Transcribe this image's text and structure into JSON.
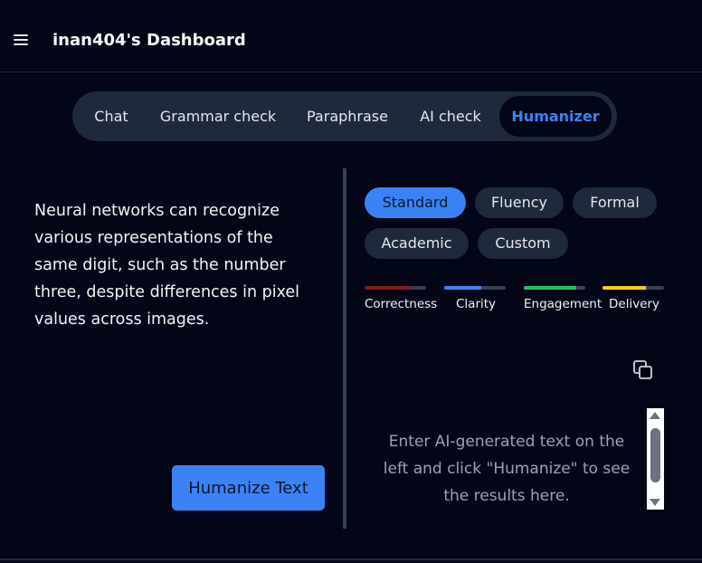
{
  "header": {
    "title": "inan404's Dashboard",
    "menu_icon": "hamburger-menu-icon"
  },
  "tabs": [
    {
      "label": "Chat",
      "active": false
    },
    {
      "label": "Grammar check",
      "active": false
    },
    {
      "label": "Paraphrase",
      "active": false
    },
    {
      "label": "AI check",
      "active": false
    },
    {
      "label": "Humanizer",
      "active": true
    }
  ],
  "input": {
    "text": "Neural networks can recognize various representations of the same digit, such as the number three, despite differences in pixel values across images."
  },
  "humanize_button": {
    "label": "Humanize Text"
  },
  "modes": [
    {
      "label": "Standard",
      "active": true
    },
    {
      "label": "Fluency",
      "active": false
    },
    {
      "label": "Formal",
      "active": false
    },
    {
      "label": "Academic",
      "active": false
    },
    {
      "label": "Custom",
      "active": false
    }
  ],
  "metrics": [
    {
      "label": "Correctness",
      "level": 0.75,
      "color": "#7f1d1d"
    },
    {
      "label": "Clarity",
      "level": 0.6,
      "color": "#3b82f6"
    },
    {
      "label": "Engagement",
      "level": 0.85,
      "color": "#22c55e"
    },
    {
      "label": "Delivery",
      "level": 0.7,
      "color": "#facc15"
    }
  ],
  "output": {
    "placeholder": "Enter AI-generated text on the left and click \"Humanize\" to see the results here.",
    "copy_icon": "copy-icon"
  },
  "colors": {
    "accent": "#3b82f6",
    "background": "#020617",
    "panel": "#1e293b"
  }
}
